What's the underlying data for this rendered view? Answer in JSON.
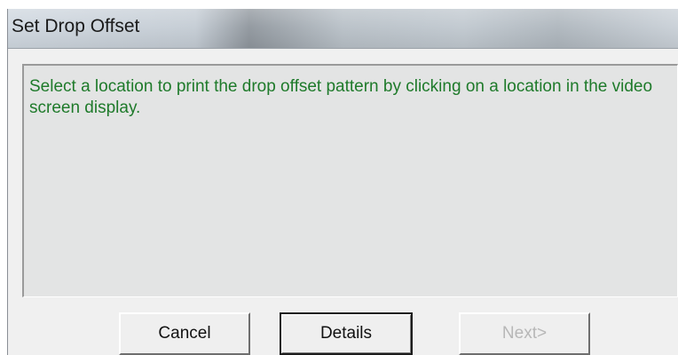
{
  "dialog": {
    "title": "Set Drop Offset",
    "message": "Select a location to print the drop offset pattern by clicking on a location in the video screen display."
  },
  "buttons": {
    "cancel": "Cancel",
    "details": "Details",
    "next": "Next>",
    "next_enabled": false
  },
  "colors": {
    "message_text": "#1e7a2a",
    "panel_background": "#e3e4e4",
    "disabled_text": "#b7b7b7"
  }
}
